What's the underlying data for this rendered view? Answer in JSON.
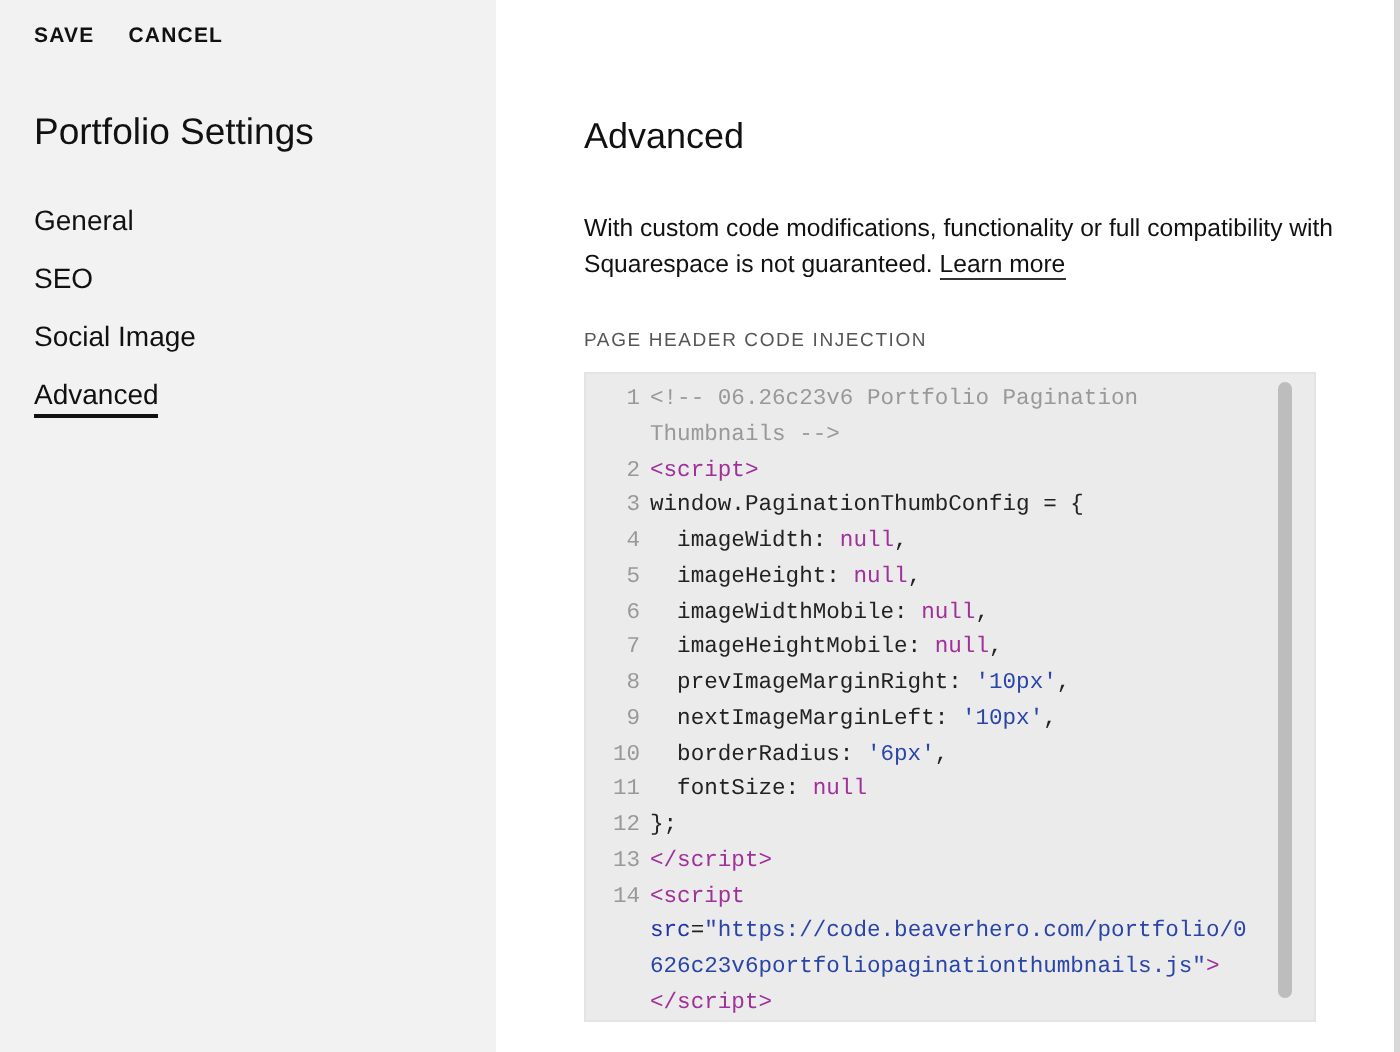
{
  "header_actions": [
    "SAVE",
    "CANCEL"
  ],
  "sidebar": {
    "title": "Portfolio Settings",
    "items": [
      {
        "label": "General",
        "selected": false
      },
      {
        "label": "SEO",
        "selected": false
      },
      {
        "label": "Social Image",
        "selected": false
      },
      {
        "label": "Advanced",
        "selected": true
      }
    ]
  },
  "main": {
    "title": "Advanced",
    "description": "With custom code modifications, functionality or full compatibility with Squarespace is not guaranteed.",
    "link": "Learn more",
    "code_section": {
      "label": "PAGE HEADER CODE INJECTION",
      "lines": [
        {
          "number": "1",
          "rows": [
            {
              "segments": [
                {
                  "kind": "comment",
                  "text": "<!-- 06.26c23v6 Portfolio Pagination"
                }
              ]
            },
            {
              "segments": [
                {
                  "kind": "comment",
                  "text": "Thumbnails -->"
                }
              ]
            }
          ]
        },
        {
          "number": "2",
          "rows": [
            {
              "segments": [
                {
                  "kind": "tag",
                  "text": "<script>"
                }
              ]
            }
          ]
        },
        {
          "number": "3",
          "rows": [
            {
              "segments": [
                {
                  "kind": "plain",
                  "text": "window.PaginationThumbConfig = {"
                }
              ]
            }
          ]
        },
        {
          "number": "4",
          "rows": [
            {
              "segments": [
                {
                  "kind": "plain",
                  "text": "  imageWidth: "
                },
                {
                  "kind": "keyword",
                  "text": "null"
                },
                {
                  "kind": "plain",
                  "text": ","
                }
              ]
            }
          ]
        },
        {
          "number": "5",
          "rows": [
            {
              "segments": [
                {
                  "kind": "plain",
                  "text": "  imageHeight: "
                },
                {
                  "kind": "keyword",
                  "text": "null"
                },
                {
                  "kind": "plain",
                  "text": ","
                }
              ]
            }
          ]
        },
        {
          "number": "6",
          "rows": [
            {
              "segments": [
                {
                  "kind": "plain",
                  "text": "  imageWidthMobile: "
                },
                {
                  "kind": "keyword",
                  "text": "null"
                },
                {
                  "kind": "plain",
                  "text": ","
                }
              ]
            }
          ]
        },
        {
          "number": "7",
          "rows": [
            {
              "segments": [
                {
                  "kind": "plain",
                  "text": "  imageHeightMobile: "
                },
                {
                  "kind": "keyword",
                  "text": "null"
                },
                {
                  "kind": "plain",
                  "text": ","
                }
              ]
            }
          ]
        },
        {
          "number": "8",
          "rows": [
            {
              "segments": [
                {
                  "kind": "plain",
                  "text": "  prevImageMarginRight: "
                },
                {
                  "kind": "string",
                  "text": "'10px'"
                },
                {
                  "kind": "plain",
                  "text": ","
                }
              ]
            }
          ]
        },
        {
          "number": "9",
          "rows": [
            {
              "segments": [
                {
                  "kind": "plain",
                  "text": "  nextImageMarginLeft: "
                },
                {
                  "kind": "string",
                  "text": "'10px'"
                },
                {
                  "kind": "plain",
                  "text": ","
                }
              ]
            }
          ]
        },
        {
          "number": "10",
          "rows": [
            {
              "segments": [
                {
                  "kind": "plain",
                  "text": "  borderRadius: "
                },
                {
                  "kind": "string",
                  "text": "'6px'"
                },
                {
                  "kind": "plain",
                  "text": ","
                }
              ]
            }
          ]
        },
        {
          "number": "11",
          "rows": [
            {
              "segments": [
                {
                  "kind": "plain",
                  "text": "  fontSize: "
                },
                {
                  "kind": "keyword",
                  "text": "null"
                }
              ]
            }
          ]
        },
        {
          "number": "12",
          "rows": [
            {
              "segments": [
                {
                  "kind": "plain",
                  "text": "};"
                }
              ]
            }
          ]
        },
        {
          "number": "13",
          "rows": [
            {
              "segments": [
                {
                  "kind": "tag",
                  "text": "</script>"
                }
              ]
            }
          ]
        },
        {
          "number": "14",
          "rows": [
            {
              "segments": [
                {
                  "kind": "tag",
                  "text": "<script"
                }
              ]
            },
            {
              "segments": [
                {
                  "kind": "attr",
                  "text": "src"
                },
                {
                  "kind": "plain",
                  "text": "="
                },
                {
                  "kind": "string",
                  "text": "\"https://code.beaverhero.com/portfolio/0"
                }
              ]
            },
            {
              "segments": [
                {
                  "kind": "string",
                  "text": "626c23v6portfoliopaginationthumbnails.js\""
                },
                {
                  "kind": "tag",
                  "text": ">"
                }
              ]
            },
            {
              "segments": [
                {
                  "kind": "tag",
                  "text": "</script>"
                }
              ]
            }
          ]
        }
      ]
    }
  }
}
